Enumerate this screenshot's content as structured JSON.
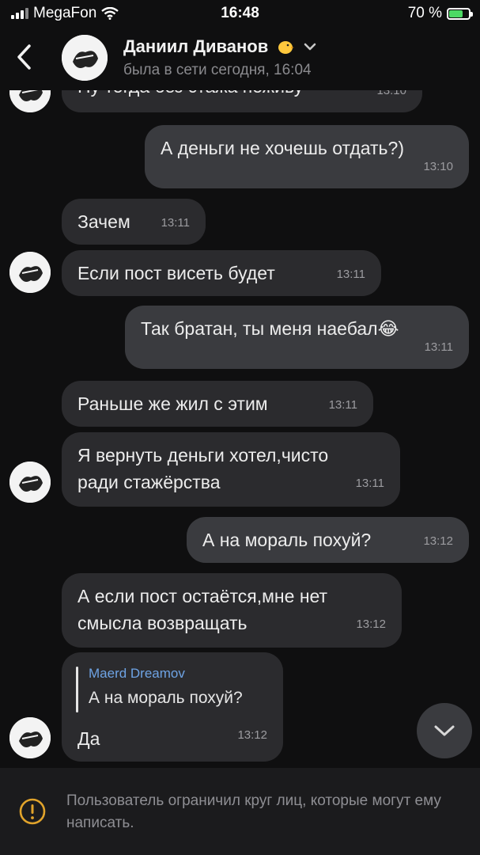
{
  "status_bar": {
    "carrier": "MegaFon",
    "time": "16:48",
    "battery_text": "70 %",
    "battery_level": 0.7
  },
  "header": {
    "name": "Даниил Диванов",
    "status": "была в сети сегодня, 16:04"
  },
  "messages": [
    {
      "id": "m0",
      "direction": "in",
      "text": "Ну тогда без стажа поживу",
      "time": "13:10"
    },
    {
      "id": "m1",
      "direction": "out",
      "text": "А деньги не хочешь отдать?)",
      "time": "13:10"
    },
    {
      "id": "m2",
      "direction": "in",
      "text": "Зачем",
      "time": "13:11"
    },
    {
      "id": "m3",
      "direction": "in",
      "text": "Если пост висеть будет",
      "time": "13:11"
    },
    {
      "id": "m4",
      "direction": "out",
      "text": "Так братан, ты меня наебал",
      "time": "13:11",
      "emoji": "😂"
    },
    {
      "id": "m5",
      "direction": "in",
      "text": "Раньше же жил с этим",
      "time": "13:11"
    },
    {
      "id": "m6",
      "direction": "in",
      "lines": [
        "Я вернуть деньги хотел,чисто",
        "ради стажёрства"
      ],
      "time": "13:11"
    },
    {
      "id": "m7",
      "direction": "out",
      "text": "А на мораль похуй?",
      "time": "13:12"
    },
    {
      "id": "m8",
      "direction": "in",
      "lines": [
        "А если пост остаётся,мне нет",
        "смысла возвращать"
      ],
      "time": "13:12"
    },
    {
      "id": "m9",
      "direction": "in",
      "reply_name": "Maerd Dreamov",
      "reply_text": "А на мораль похуй?",
      "text": "Да",
      "time": "13:12"
    }
  ],
  "footer": {
    "note": "Пользователь ограничил круг лиц, которые могут ему написать."
  },
  "colors": {
    "background": "#0f0f10",
    "incoming": "#2b2b2e",
    "outgoing": "#3a3b3f",
    "reply_accent": "#6ea3e4",
    "battery": "#4cd964"
  },
  "icons": [
    "back-chevron-icon",
    "chick-emoji-icon",
    "chevron-down-icon",
    "scroll-down-icon",
    "warning-icon"
  ]
}
